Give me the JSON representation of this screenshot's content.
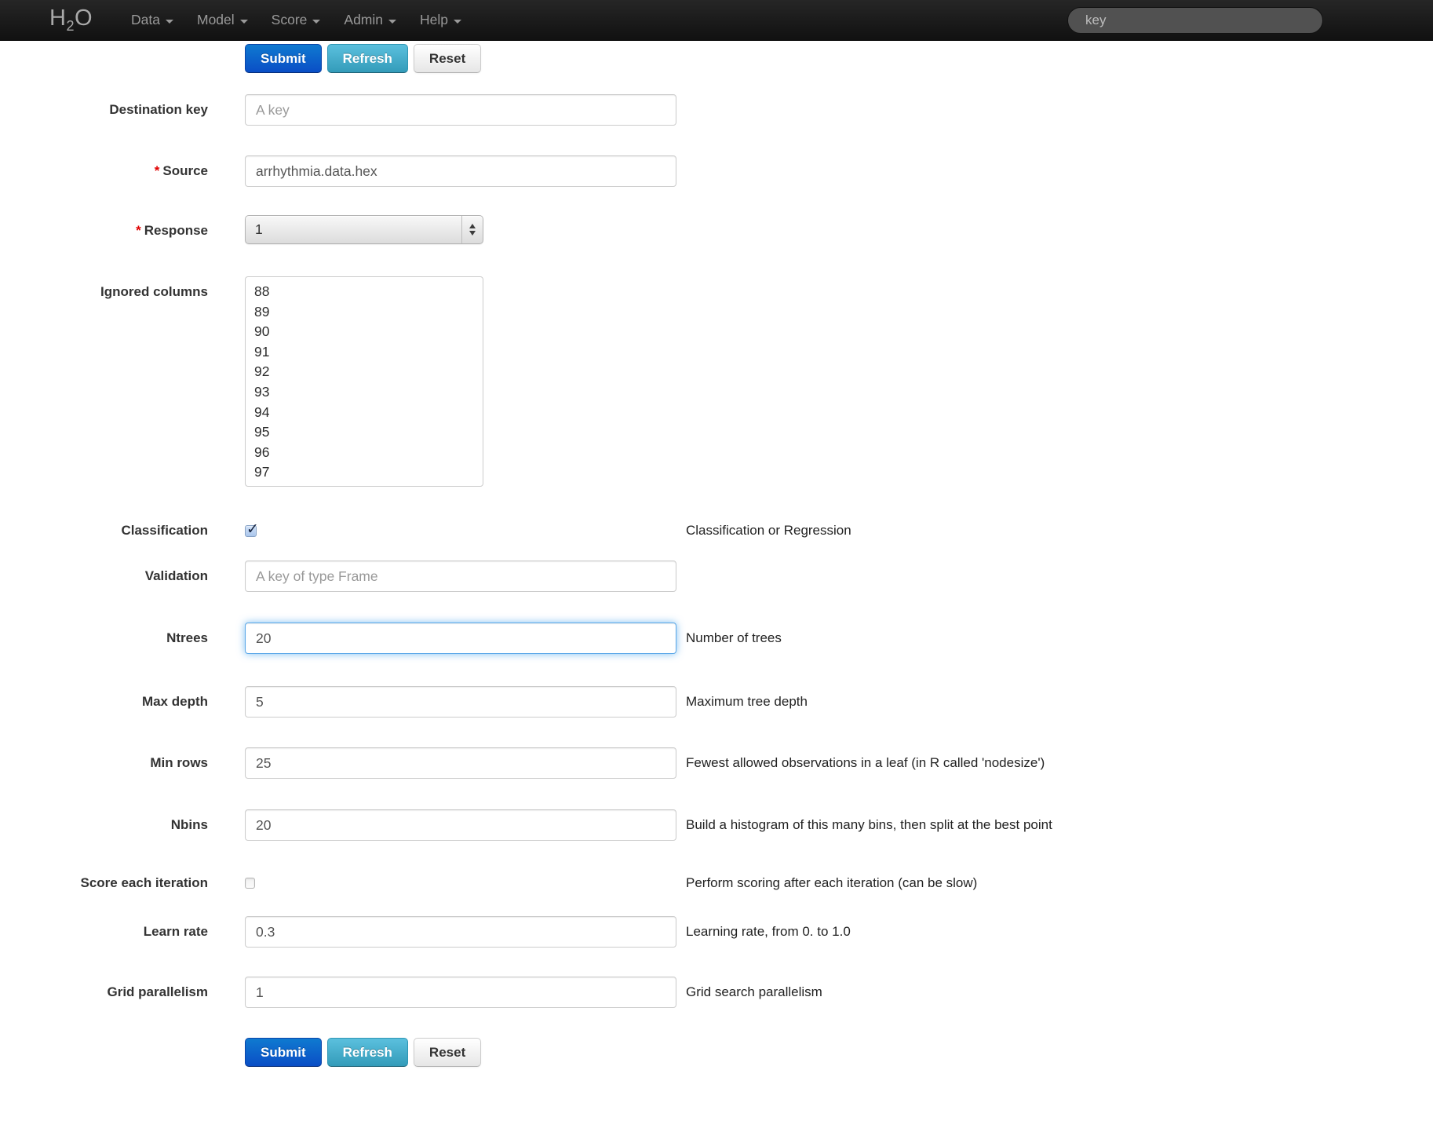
{
  "navbar": {
    "brand": "H₂O",
    "menus": [
      {
        "label": "Data"
      },
      {
        "label": "Model"
      },
      {
        "label": "Score"
      },
      {
        "label": "Admin"
      },
      {
        "label": "Help"
      }
    ],
    "search": {
      "placeholder": "key"
    }
  },
  "buttons": {
    "submit": "Submit",
    "refresh": "Refresh",
    "reset": "Reset"
  },
  "form": {
    "destination_key": {
      "label": "Destination key",
      "placeholder": "A key"
    },
    "source": {
      "label": "Source",
      "required_marker": "*",
      "value": "arrhythmia.data.hex"
    },
    "response": {
      "label": "Response",
      "required_marker": "*",
      "value": "1"
    },
    "ignored_columns": {
      "label": "Ignored columns",
      "items": [
        "88",
        "89",
        "90",
        "91",
        "92",
        "93",
        "94",
        "95",
        "96",
        "97"
      ]
    },
    "classification": {
      "label": "Classification",
      "checked": true,
      "help": "Classification or Regression"
    },
    "validation": {
      "label": "Validation",
      "placeholder": "A key of type Frame"
    },
    "ntrees": {
      "label": "Ntrees",
      "value": "20",
      "help": "Number of trees"
    },
    "max_depth": {
      "label": "Max depth",
      "value": "5",
      "help": "Maximum tree depth"
    },
    "min_rows": {
      "label": "Min rows",
      "value": "25",
      "help": "Fewest allowed observations in a leaf (in R called 'nodesize')"
    },
    "nbins": {
      "label": "Nbins",
      "value": "20",
      "help": "Build a histogram of this many bins, then split at the best point"
    },
    "score_each_iteration": {
      "label": "Score each iteration",
      "checked": false,
      "help": "Perform scoring after each iteration (can be slow)"
    },
    "learn_rate": {
      "label": "Learn rate",
      "value": "0.3",
      "help": "Learning rate, from 0. to 1.0"
    },
    "grid_parallelism": {
      "label": "Grid parallelism",
      "value": "1",
      "help": "Grid search parallelism"
    }
  },
  "colors": {
    "navbar_bg": "#1b1b1b",
    "nav_link": "#999999",
    "primary_button_top": "#0f7ad0",
    "primary_button_bottom": "#0a4ec6",
    "info_button_top": "#5bc0de",
    "info_button_bottom": "#339bb9",
    "focus_glow": "#52a8ec",
    "required_asterisk": "#e00000"
  }
}
